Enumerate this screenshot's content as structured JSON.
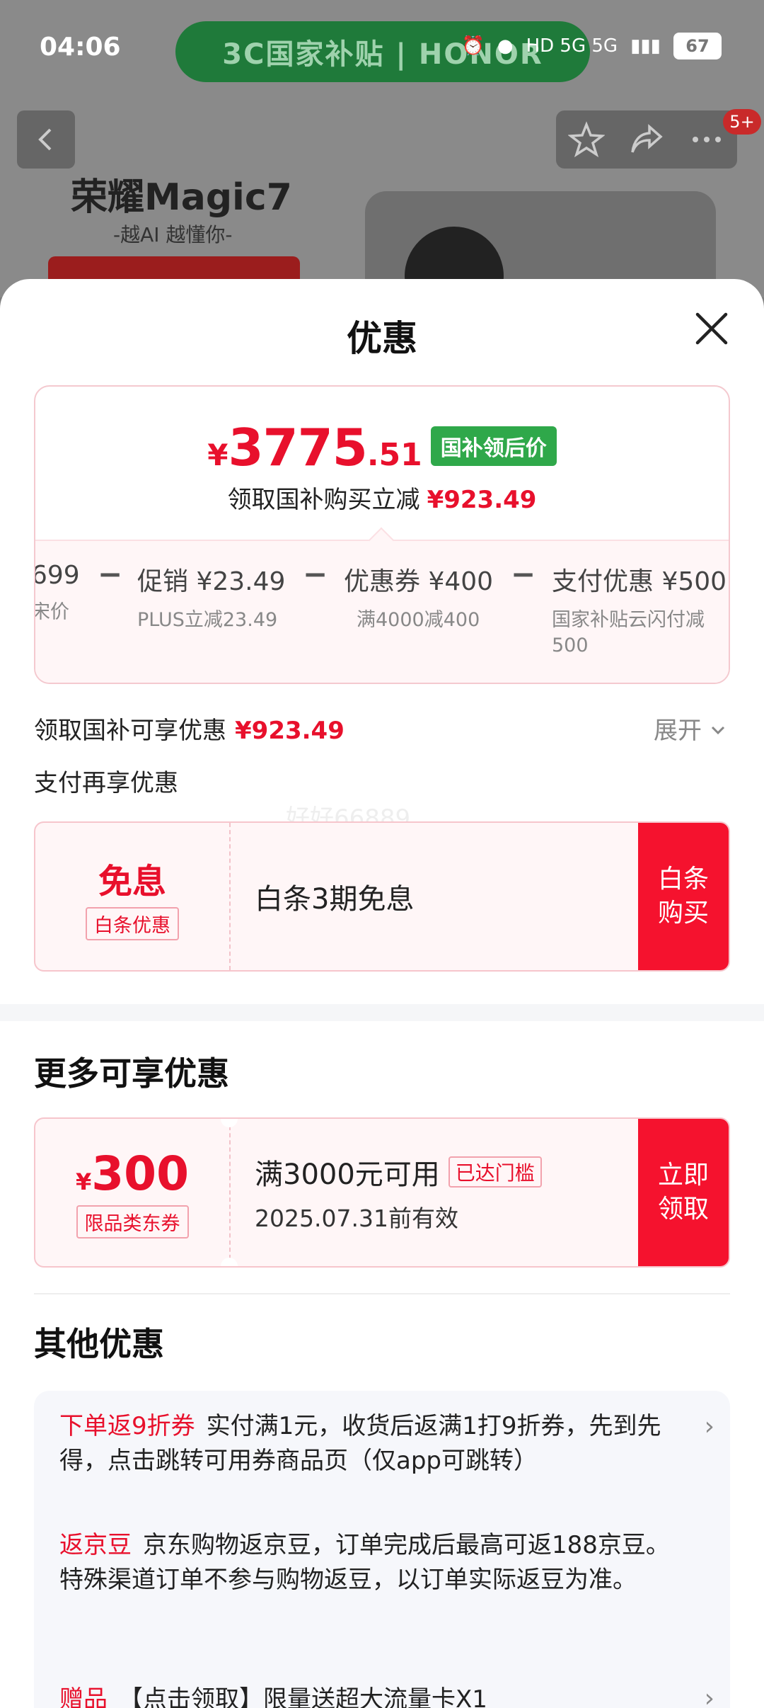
{
  "status_bar": {
    "time": "04:06",
    "banner": "3C国家补贴 | HONOR",
    "network": "HD 5G 5G",
    "battery": "67"
  },
  "background": {
    "product_title": "荣耀Magic7",
    "product_subtitle": "-越AI 越懂你-",
    "badge_count": "5+"
  },
  "sheet": {
    "title": "优惠",
    "price": {
      "yen": "¥",
      "integer": "3775",
      "decimal": ".51",
      "tag": "国补领后价",
      "subtitle": "领取国补购买立减",
      "saving": "¥923.49"
    },
    "breakdown": [
      {
        "main": "699",
        "sub": "宋价"
      },
      {
        "main": "促销 ¥23.49",
        "sub": "PLUS立减23.49"
      },
      {
        "main": "优惠券 ¥400",
        "sub": "满4000减400"
      },
      {
        "main": "支付优惠 ¥500",
        "sub": "国家补贴云闪付减500"
      }
    ],
    "gov_label": "领取国补可享优惠",
    "gov_value": "¥923.49",
    "expand": "展开",
    "pay_again": "支付再享优惠",
    "watermark": "好好66889",
    "baitiao": {
      "big": "免息",
      "label": "白条优惠",
      "text": "白条3期免息",
      "button": "白条购买"
    },
    "more_title": "更多可享优惠",
    "coupon300": {
      "yen": "¥",
      "amount": "300",
      "label": "限品类东券",
      "condition": "满3000元可用",
      "status_tag": "已达门槛",
      "expiry": "2025.07.31前有效",
      "button": "立即领取"
    },
    "other_title": "其他优惠",
    "other_items": [
      {
        "tag": "下单返9折券",
        "text": "实付满1元，收货后返满1打9折券，先到先得，点击跳转可用券商品页（仅app可跳转）"
      },
      {
        "tag": "返京豆",
        "text": "京东购物返京豆，订单完成后最高可返188京豆。特殊渠道订单不参与购物返豆，以订单实际返豆为准。"
      },
      {
        "tag": "赠品",
        "text": "【点击领取】限量送超大流量卡X1"
      }
    ]
  }
}
